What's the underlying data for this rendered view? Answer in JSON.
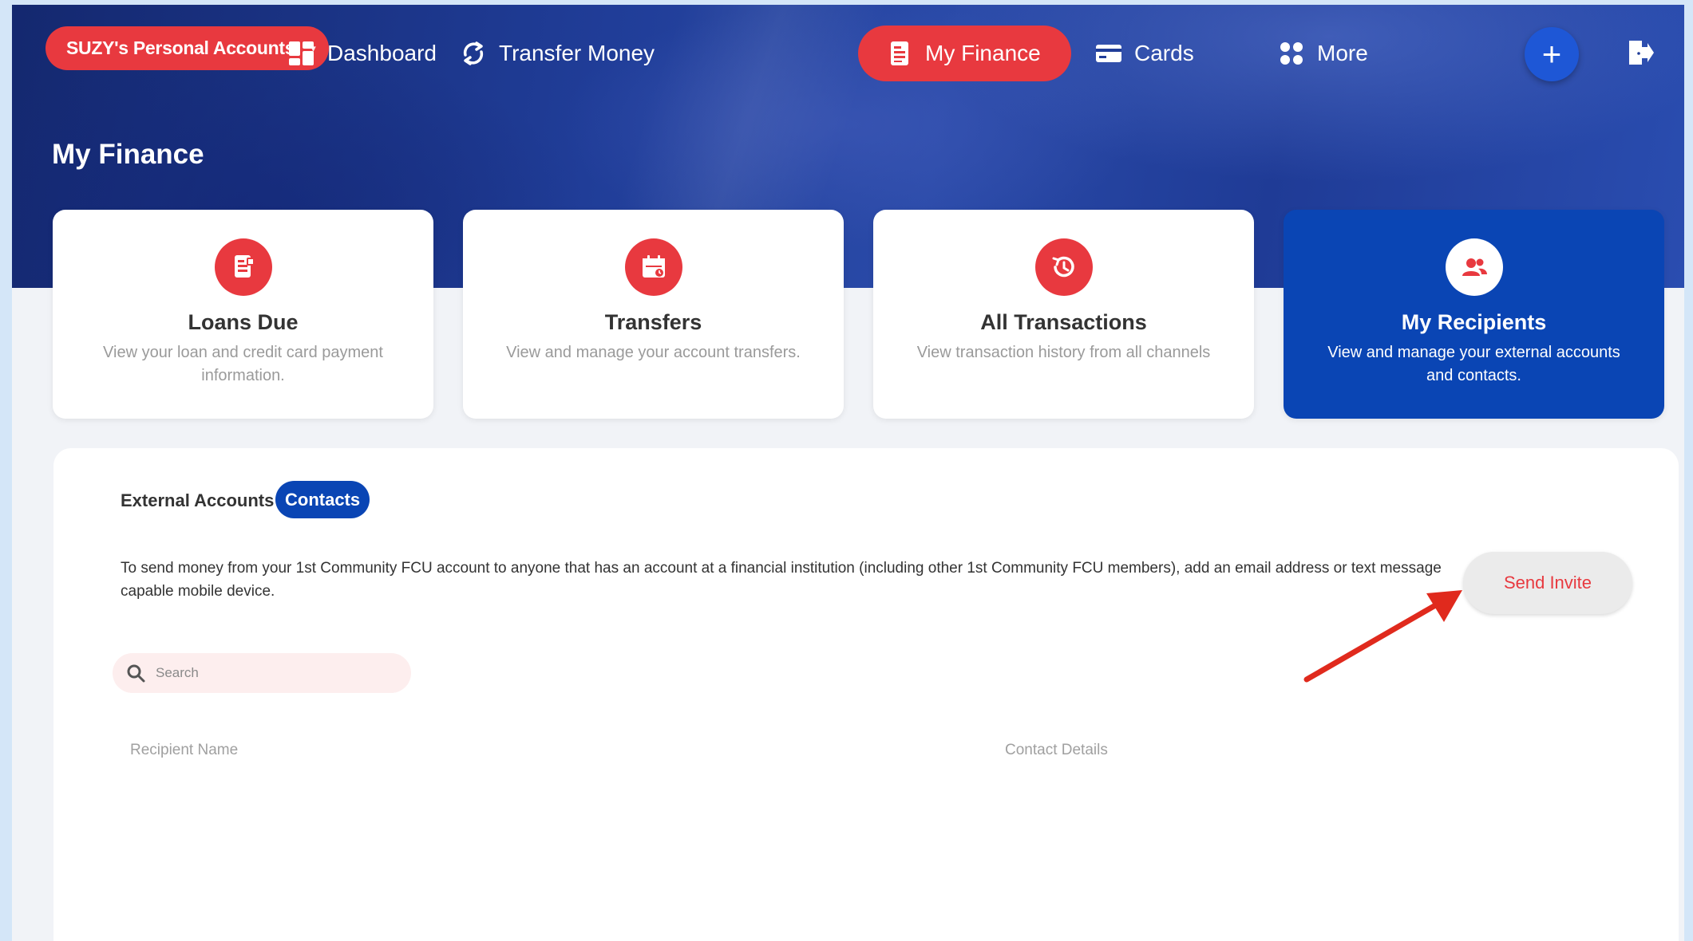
{
  "account_selector": {
    "label": "SUZY's Personal Accounts",
    "caret": "▾"
  },
  "nav": {
    "items": [
      {
        "label": "Dashboard",
        "icon": "dashboard-icon"
      },
      {
        "label": "Transfer Money",
        "icon": "transfer-icon"
      },
      {
        "label": "My Finance",
        "icon": "finance-icon",
        "active": true
      },
      {
        "label": "Cards",
        "icon": "card-icon"
      },
      {
        "label": "More",
        "icon": "grid-icon"
      }
    ],
    "plus_label": "+"
  },
  "page": {
    "title": "My Finance"
  },
  "tiles": [
    {
      "title": "Loans Due",
      "desc": "View your loan and credit card payment information.",
      "icon": "loan-icon"
    },
    {
      "title": "Transfers",
      "desc": "View and manage your account transfers.",
      "icon": "calendar-icon"
    },
    {
      "title": "All Transactions",
      "desc": "View transaction history from all channels",
      "icon": "history-icon"
    },
    {
      "title": "My Recipients",
      "desc": "View and manage your external accounts and contacts.",
      "icon": "people-icon",
      "active": true
    }
  ],
  "recipients": {
    "tabs": [
      "External Accounts",
      "Contacts"
    ],
    "active_tab": "Contacts",
    "info_text": "To send money from your 1st Community FCU account to anyone that has an account at a financial institution (including other 1st Community FCU members), add an email address or text message capable mobile device.",
    "send_invite_label": "Send Invite",
    "search_placeholder": "Search",
    "columns": [
      "Recipient Name",
      "Contact Details"
    ]
  },
  "colors": {
    "accent_red": "#e8393f",
    "primary_blue": "#0a45b4",
    "hero_blue": "#203d98"
  }
}
